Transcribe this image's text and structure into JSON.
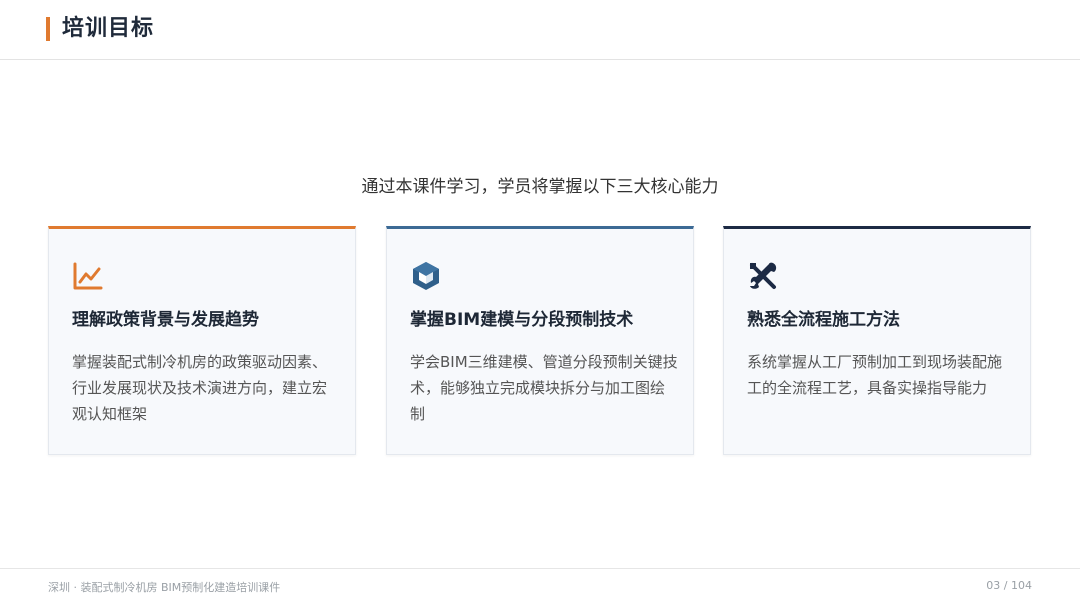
{
  "header": {
    "title": "培训目标"
  },
  "intro": "通过本课件学习，学员将掌握以下三大核心能力",
  "cards": [
    {
      "icon": "chart-line-icon",
      "accent": "#e07a2f",
      "title": "理解政策背景与发展趋势",
      "desc": "掌握装配式制冷机房的政策驱动因素、行业发展现状及技术演进方向，建立宏观认知框架"
    },
    {
      "icon": "cube-icon",
      "accent": "#3c6a95",
      "title": "掌握BIM建模与分段预制技术",
      "desc": "学会BIM三维建模、管道分段预制关键技术，能够独立完成模块拆分与加工图绘制"
    },
    {
      "icon": "tools-icon",
      "accent": "#1c2a44",
      "title": "熟悉全流程施工方法",
      "desc": "系统掌握从工厂预制加工到现场装配施工的全流程工艺，具备实操指导能力"
    }
  ],
  "footer": {
    "left": "深圳 · 装配式制冷机房 BIM预制化建造培训课件",
    "right": "03 / 104"
  },
  "colors": {
    "accent": "#e07a2f",
    "header_bar": "#e07a2f"
  }
}
